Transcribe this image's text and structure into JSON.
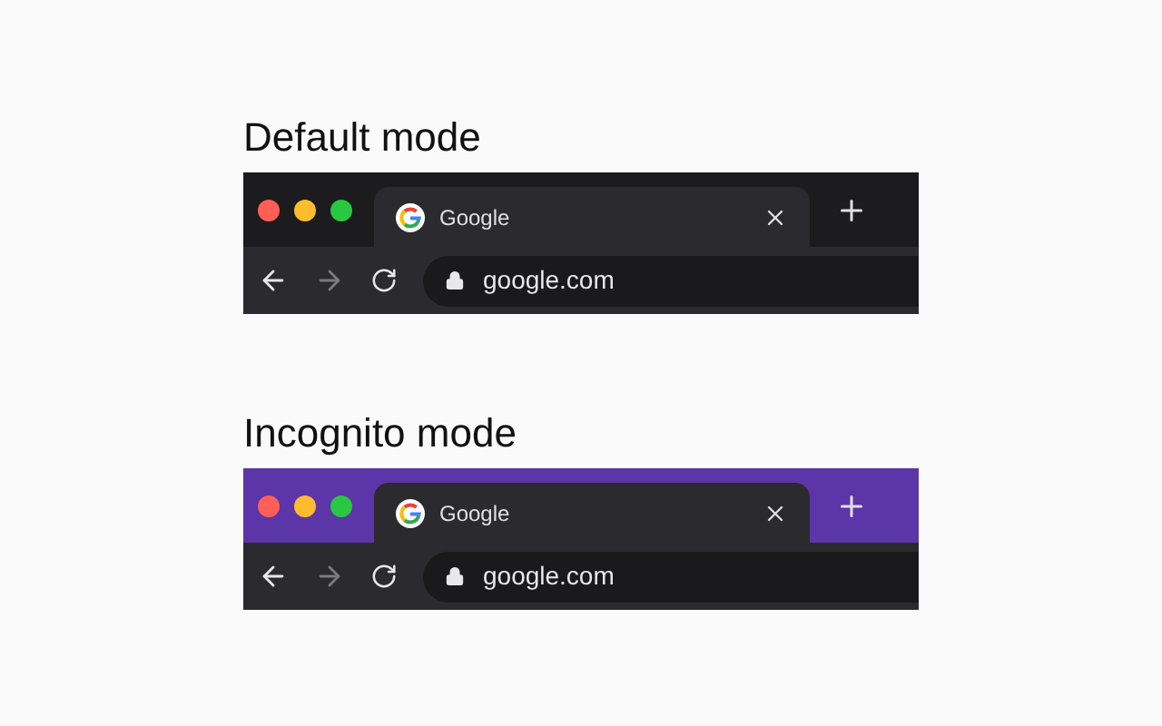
{
  "sections": [
    {
      "heading": "Default mode",
      "kind": "default",
      "tab": {
        "title": "Google"
      },
      "navigation": {
        "back_disabled": false,
        "forward_disabled": true
      },
      "address": "google.com"
    },
    {
      "heading": "Incognito mode",
      "kind": "incognito",
      "tab": {
        "title": "Google"
      },
      "navigation": {
        "back_disabled": false,
        "forward_disabled": true
      },
      "address": "google.com"
    }
  ]
}
